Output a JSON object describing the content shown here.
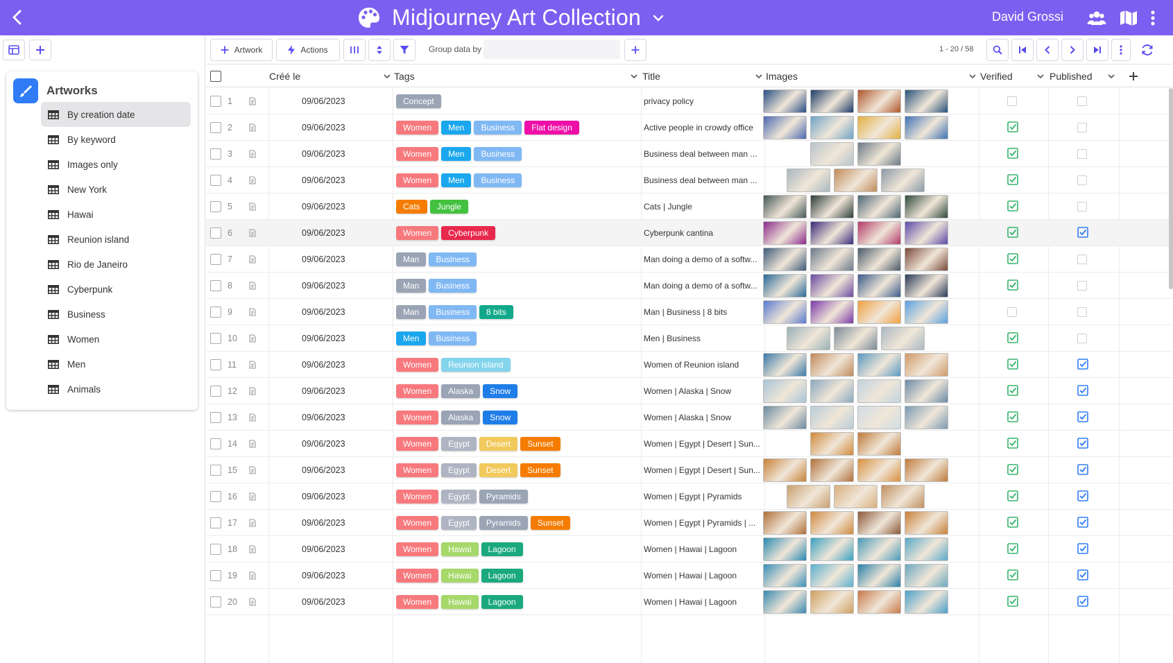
{
  "app": {
    "title": "Midjourney Art Collection",
    "user": "David Grossi",
    "accent": "#7b5ff0"
  },
  "toolbar": {
    "artwork_label": "Artwork",
    "actions_label": "Actions",
    "group_label": "Group data by",
    "group_value": "",
    "page_info": "1 - 20 / 58"
  },
  "sidebar": {
    "heading": "Artworks",
    "items": [
      {
        "label": "By creation date",
        "active": true
      },
      {
        "label": "By keyword"
      },
      {
        "label": "Images only"
      },
      {
        "label": "New York"
      },
      {
        "label": "Hawai"
      },
      {
        "label": "Reunion island"
      },
      {
        "label": "Rio de Janeiro"
      },
      {
        "label": "Cyberpunk"
      },
      {
        "label": "Business"
      },
      {
        "label": "Women"
      },
      {
        "label": "Men"
      },
      {
        "label": "Animals"
      }
    ]
  },
  "columns": {
    "created": "Créé le",
    "tags": "Tags",
    "title": "Title",
    "images": "Images",
    "verified": "Verified",
    "published": "Published"
  },
  "tag_colors": {
    "Concept": "#9aa4b5",
    "Women": "#f7797d",
    "Men": "#1aa7ee",
    "Man": "#9aa4b5",
    "Business": "#80b8f4",
    "Flat design": "#ef0fa8",
    "Cats": "#f57c00",
    "Jungle": "#43c13f",
    "Cyberpunk": "#e8284c",
    "8 bits": "#12a98a",
    "Reunion island": "#84d4ec",
    "Alaska": "#9aa4b5",
    "Snow": "#1f7de8",
    "Egypt": "#aeb4c2",
    "Desert": "#f1c95c",
    "Sunset": "#f57c00",
    "Pyramids": "#9aa4b5",
    "Hawai": "#a6d86a",
    "Lagoon": "#1aa97e"
  },
  "rows": [
    {
      "n": "1",
      "date": "09/06/2023",
      "tags": [
        "Concept"
      ],
      "title": "privacy policy",
      "images": 4,
      "palette": [
        "#2a4f86",
        "#1d3c67",
        "#b0562a",
        "#28527a"
      ],
      "verified": false,
      "published": false
    },
    {
      "n": "2",
      "date": "09/06/2023",
      "tags": [
        "Women",
        "Men",
        "Business",
        "Flat design"
      ],
      "title": "Active people in crowdy office",
      "images": 4,
      "palette": [
        "#4b6ab0",
        "#6fa3c7",
        "#e3b042",
        "#3e72b3"
      ],
      "verified": true,
      "published": false
    },
    {
      "n": "3",
      "date": "09/06/2023",
      "tags": [
        "Women",
        "Men",
        "Business"
      ],
      "title": "Business deal between man ...",
      "images": 2,
      "palette": [
        "#b8c4cc",
        "#6a7a86"
      ],
      "verified": true,
      "published": false
    },
    {
      "n": "4",
      "date": "09/06/2023",
      "tags": [
        "Women",
        "Men",
        "Business"
      ],
      "title": "Business deal between man ...",
      "images": 3,
      "palette": [
        "#a9b8bf",
        "#c08b5a",
        "#8a9aa8"
      ],
      "verified": true,
      "published": false
    },
    {
      "n": "5",
      "date": "09/06/2023",
      "tags": [
        "Cats",
        "Jungle"
      ],
      "title": "Cats | Jungle",
      "images": 4,
      "palette": [
        "#45585a",
        "#2c3d3a",
        "#4d6676",
        "#2f4a3e"
      ],
      "verified": true,
      "published": false
    },
    {
      "n": "6",
      "date": "09/06/2023",
      "tags": [
        "Women",
        "Cyberpunk"
      ],
      "title": "Cyberpunk cantina",
      "images": 4,
      "palette": [
        "#8a2a8c",
        "#3a2a7a",
        "#b33a6a",
        "#5a4aa8"
      ],
      "verified": true,
      "published": true,
      "highlight": true
    },
    {
      "n": "7",
      "date": "09/06/2023",
      "tags": [
        "Man",
        "Business"
      ],
      "title": "Man doing a demo of a softw...",
      "images": 4,
      "palette": [
        "#3d5a7a",
        "#6a7a8a",
        "#4a5a6a",
        "#7a4a3a"
      ],
      "verified": true,
      "published": false
    },
    {
      "n": "8",
      "date": "09/06/2023",
      "tags": [
        "Man",
        "Business"
      ],
      "title": "Man doing a demo of a softw...",
      "images": 4,
      "palette": [
        "#2a6a9a",
        "#6a4aa0",
        "#3a5a8a",
        "#2a3a5a"
      ],
      "verified": true,
      "published": false
    },
    {
      "n": "9",
      "date": "09/06/2023",
      "tags": [
        "Man",
        "Business",
        "8 bits"
      ],
      "title": "Man | Business | 8 bits",
      "images": 4,
      "palette": [
        "#5a7ad0",
        "#7a3aa8",
        "#f0a040",
        "#5aa0e0"
      ],
      "verified": false,
      "published": false
    },
    {
      "n": "10",
      "date": "09/06/2023",
      "tags": [
        "Men",
        "Business"
      ],
      "title": "Men | Business",
      "images": 3,
      "palette": [
        "#9ab0b8",
        "#7a8a96",
        "#aab8c2"
      ],
      "verified": true,
      "published": false
    },
    {
      "n": "11",
      "date": "09/06/2023",
      "tags": [
        "Women",
        "Reunion island"
      ],
      "title": "Women of Reunion island",
      "images": 4,
      "palette": [
        "#3a7aa8",
        "#c08a5a",
        "#5a9ac0",
        "#d09a6a"
      ],
      "verified": true,
      "published": true
    },
    {
      "n": "12",
      "date": "09/06/2023",
      "tags": [
        "Women",
        "Alaska",
        "Snow"
      ],
      "title": "Women | Alaska | Snow",
      "images": 4,
      "palette": [
        "#a8c4d8",
        "#8aa8c0",
        "#c0d4e0",
        "#6a8aa8"
      ],
      "verified": true,
      "published": true
    },
    {
      "n": "13",
      "date": "09/06/2023",
      "tags": [
        "Women",
        "Alaska",
        "Snow"
      ],
      "title": "Women | Alaska | Snow",
      "images": 4,
      "palette": [
        "#6a8aa0",
        "#b8ccd8",
        "#d0dce4",
        "#7a9ab4"
      ],
      "verified": true,
      "published": true
    },
    {
      "n": "14",
      "date": "09/06/2023",
      "tags": [
        "Women",
        "Egypt",
        "Desert",
        "Sunset"
      ],
      "title": "Women | Egypt | Desert | Sun...",
      "images": 2,
      "palette": [
        "#d08a3a",
        "#c07a3a"
      ],
      "verified": true,
      "published": true
    },
    {
      "n": "15",
      "date": "09/06/2023",
      "tags": [
        "Women",
        "Egypt",
        "Desert",
        "Sunset"
      ],
      "title": "Women | Egypt | Desert | Sun...",
      "images": 4,
      "palette": [
        "#c8823a",
        "#b0703a",
        "#d89040",
        "#c07a3a"
      ],
      "verified": true,
      "published": true
    },
    {
      "n": "16",
      "date": "09/06/2023",
      "tags": [
        "Women",
        "Egypt",
        "Pyramids"
      ],
      "title": "Women | Egypt | Pyramids",
      "images": 3,
      "palette": [
        "#c8a070",
        "#d8b080",
        "#c09060"
      ],
      "verified": true,
      "published": true
    },
    {
      "n": "17",
      "date": "09/06/2023",
      "tags": [
        "Women",
        "Egypt",
        "Pyramids",
        "Sunset"
      ],
      "title": "Women | Egypt | Pyramids | ...",
      "images": 4,
      "palette": [
        "#b0703a",
        "#d08a40",
        "#8a5a3a",
        "#c8803a"
      ],
      "verified": true,
      "published": true
    },
    {
      "n": "18",
      "date": "09/06/2023",
      "tags": [
        "Women",
        "Hawai",
        "Lagoon"
      ],
      "title": "Women | Hawai | Lagoon",
      "images": 4,
      "palette": [
        "#2a8ab0",
        "#3aa0c0",
        "#4a9ab8",
        "#5aa8c8"
      ],
      "verified": true,
      "published": true
    },
    {
      "n": "19",
      "date": "09/06/2023",
      "tags": [
        "Women",
        "Hawai",
        "Lagoon"
      ],
      "title": "Women | Hawai | Lagoon",
      "images": 4,
      "palette": [
        "#3a90b8",
        "#5ab0d0",
        "#2a80a8",
        "#6aa8c0"
      ],
      "verified": true,
      "published": true
    },
    {
      "n": "20",
      "date": "09/06/2023",
      "tags": [
        "Women",
        "Hawai",
        "Lagoon"
      ],
      "title": "Women | Hawai | Lagoon",
      "images": 4,
      "palette": [
        "#3a8ab0",
        "#d0a060",
        "#c87a4a",
        "#4aa0c8"
      ],
      "verified": true,
      "published": true
    }
  ]
}
